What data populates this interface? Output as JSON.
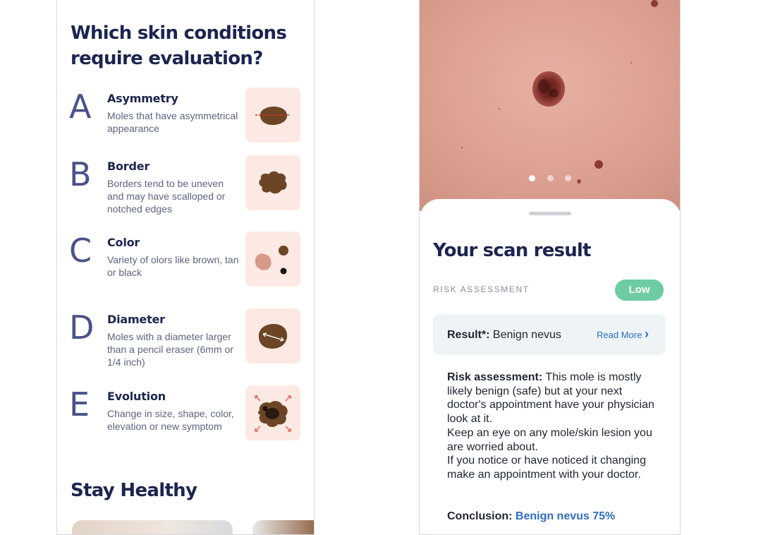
{
  "left": {
    "title": "Which skin conditions require evaluation?",
    "abcde": [
      {
        "letter": "A",
        "heading": "Asymmetry",
        "description": "Moles that have asymmetrical appearance",
        "icon": "asymmetric-mole-icon"
      },
      {
        "letter": "B",
        "heading": "Border",
        "description": "Borders tend to be uneven and may have scalloped or notched edges",
        "icon": "irregular-border-mole-icon"
      },
      {
        "letter": "C",
        "heading": "Color",
        "description": "Variety of olors like brown, tan or black",
        "icon": "multi-color-moles-icon"
      },
      {
        "letter": "D",
        "heading": "Diameter",
        "description": "Moles with a diameter larger than a pencil eraser (6mm or 1/4 inch)",
        "icon": "diameter-mole-icon"
      },
      {
        "letter": "E",
        "heading": "Evolution",
        "description": "Change in size, shape, color, elevation or new symptom",
        "icon": "evolving-mole-icon"
      }
    ],
    "section_title": "Stay Healthy"
  },
  "right": {
    "carousel": {
      "pages": 3,
      "active_index": 0
    },
    "sheet": {
      "title": "Your scan result",
      "risk_label": "RISK ASSESSMENT",
      "risk_level": "Low",
      "result_label": "Result*:",
      "result_value": "Benign nevus",
      "read_more": "Read More",
      "assessment_label": "Risk assessment:",
      "assessment_text": "This mole is mostly likely benign (safe) but at your next doctor's appointment have your physician look at it.",
      "keep_eye_text": "Keep an eye on any mole/skin lesion you are worried about.",
      "notice_text": "If you notice or have noticed it changing make an appointment with your doctor.",
      "conclusion_label": "Conclusion:",
      "conclusion_value": "Benign nevus 75%"
    }
  },
  "colors": {
    "navy": "#1c2450",
    "letter": "#4c5188",
    "tile_bg": "#fde9e3",
    "mole": "#6b4525",
    "badge_green": "#6dcca2",
    "link_blue": "#2f6dc0",
    "result_bg": "#eef4f6"
  }
}
